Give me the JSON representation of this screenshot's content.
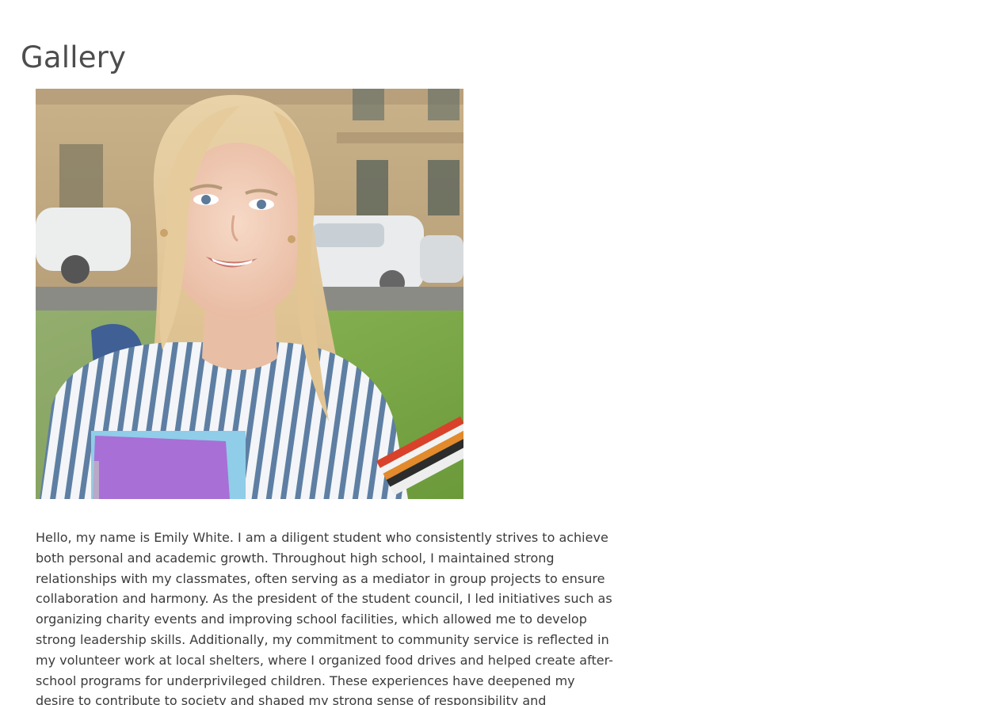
{
  "page": {
    "title": "Gallery"
  },
  "gallery": {
    "photo_name": "student-portrait",
    "bio": "Hello, my name is Emily White. I am a diligent student who consistently strives to achieve both personal and academic growth. Throughout high school, I maintained strong relationships with my classmates, often serving as a mediator in group projects to ensure collaboration and harmony. As the president of the student council, I led initiatives such as organizing charity events and improving school facilities, which allowed me to develop strong leadership skills. Additionally, my commitment to community service is reflected in my volunteer work at local shelters, where I organized food drives and helped create after-school programs for underprivileged children. These experiences have deepened my desire to contribute to society and shaped my strong sense of responsibility and compassion for others."
  },
  "colors": {
    "title": "#4d4d4d",
    "text": "#3b3b3b",
    "background": "#ffffff"
  }
}
